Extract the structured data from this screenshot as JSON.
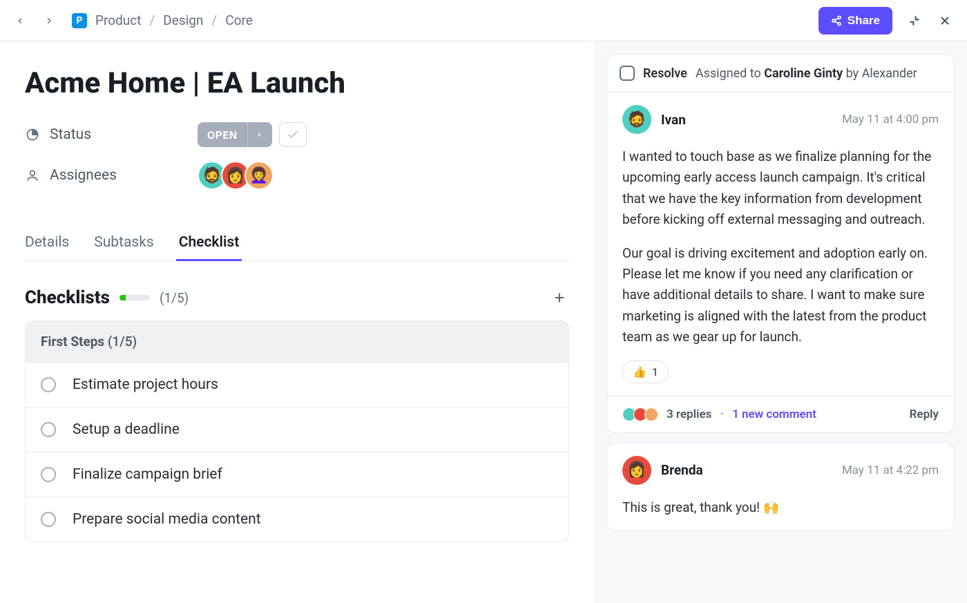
{
  "breadcrumb": {
    "icon_letter": "P",
    "items": [
      "Product",
      "Design",
      "Core"
    ]
  },
  "topbar": {
    "share_label": "Share"
  },
  "page": {
    "title": "Acme Home | EA Launch"
  },
  "meta": {
    "status_label": "Status",
    "status_value": "OPEN",
    "assignees_label": "Assignees",
    "assignees": [
      {
        "color": "av-teal",
        "emoji": "🧔"
      },
      {
        "color": "av-red",
        "emoji": "👩"
      },
      {
        "color": "av-orange",
        "emoji": "👩‍🦱"
      }
    ]
  },
  "tabs": [
    {
      "label": "Details",
      "active": false
    },
    {
      "label": "Subtasks",
      "active": false
    },
    {
      "label": "Checklist",
      "active": true
    }
  ],
  "checklists": {
    "title": "Checklists",
    "progress_label": "(1/5)",
    "progress_percent": 20,
    "groups": [
      {
        "name": "First Steps",
        "count": "(1/5)",
        "items": [
          "Estimate project hours",
          "Setup a deadline",
          "Finalize campaign brief",
          "Prepare social media content"
        ]
      }
    ]
  },
  "thread": {
    "resolve_label": "Resolve",
    "assigned_prefix": "Assigned to",
    "assigned_to": "Caroline Ginty",
    "assigned_by_prefix": "by",
    "assigned_by": "Alexander",
    "comments": [
      {
        "author": "Ivan",
        "avatar_color": "av-teal",
        "avatar_emoji": "🧔",
        "time": "May 11 at 4:00 pm",
        "paragraphs": [
          "I wanted to touch base as we finalize planning for the upcoming early access launch campaign. It's critical that we have the key information from development before kicking off external messaging and outreach.",
          "Our goal is driving excitement and adoption early on. Please let me know if you need any clarification or have additional details to share. I want to make sure marketing is aligned with the latest from the product team as we gear up for launch."
        ],
        "reaction_emoji": "👍",
        "reaction_count": "1"
      },
      {
        "author": "Brenda",
        "avatar_color": "av-red",
        "avatar_emoji": "👩",
        "time": "May 11 at 4:22 pm",
        "paragraphs": [
          "This is great, thank you! 🙌"
        ]
      }
    ],
    "footer": {
      "replies": "3 replies",
      "new_comment": "1 new comment",
      "reply_label": "Reply"
    }
  }
}
